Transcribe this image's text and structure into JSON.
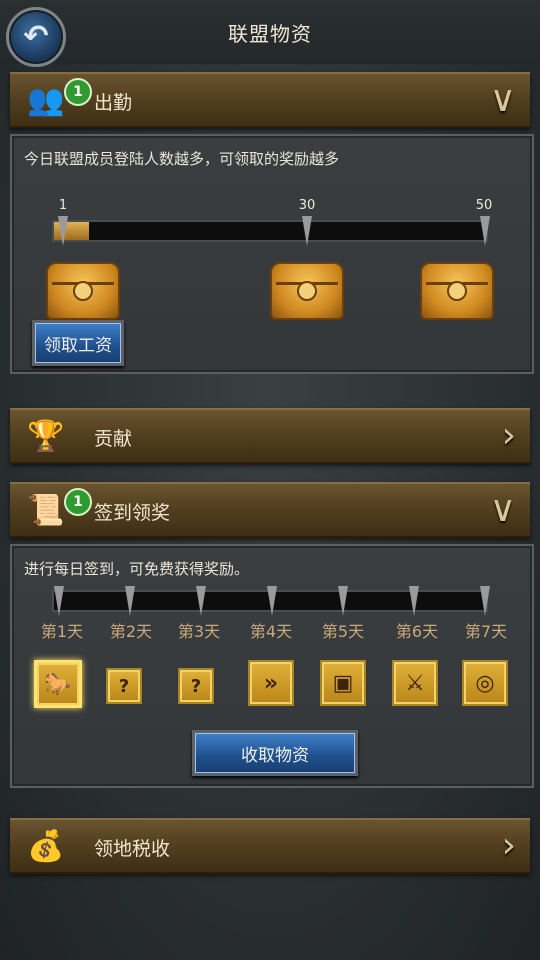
{
  "header": {
    "title": "联盟物资",
    "back_icon": "back-arrow-icon"
  },
  "sections": {
    "attendance": {
      "label": "出勤",
      "badge": "1",
      "description": "今日联盟成员登陆人数越多，可领取的奖励越多",
      "progress_ticks": [
        "1",
        "30",
        "50"
      ],
      "progress_value": 1,
      "progress_max": 50,
      "button": "领取工资"
    },
    "contribution": {
      "label": "贡献"
    },
    "checkin": {
      "label": "签到领奖",
      "badge": "1",
      "description": "进行每日签到，可免费获得奖励。",
      "days": [
        "第1天",
        "第2天",
        "第3天",
        "第4天",
        "第5天",
        "第6天",
        "第7天"
      ],
      "rewards": [
        "horse",
        "mystery",
        "mystery",
        "speedup",
        "chest",
        "cavalry",
        "coins"
      ],
      "button": "收取物资"
    },
    "tax": {
      "label": "领地税收"
    }
  }
}
